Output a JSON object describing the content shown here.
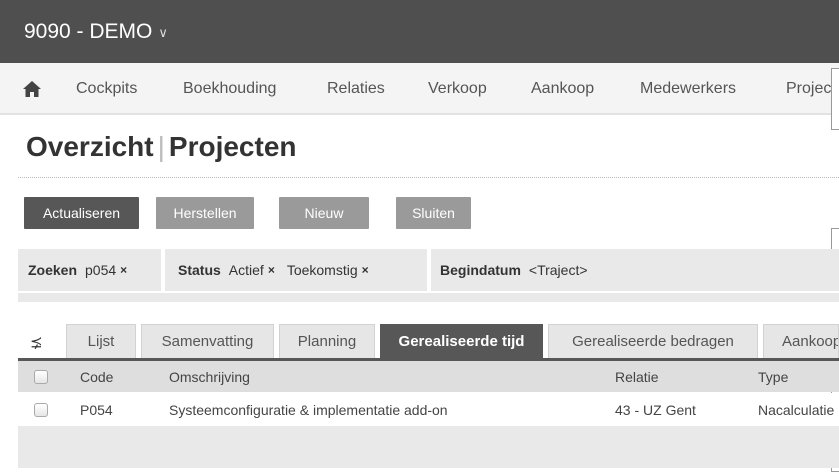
{
  "topbar": {
    "company": "9090 - DEMO",
    "chevron": "∨"
  },
  "nav": {
    "home_icon": "home-icon",
    "items": [
      "Cockpits",
      "Boekhouding",
      "Relaties",
      "Verkoop",
      "Aankoop",
      "Medewerkers",
      "Projecten"
    ]
  },
  "page": {
    "title_part1": "Overzicht",
    "title_sep": "|",
    "title_part2": "Projecten"
  },
  "toolbar": {
    "actualiseren": "Actualiseren",
    "herstellen": "Herstellen",
    "nieuw": "Nieuw",
    "sluiten": "Sluiten"
  },
  "filters": {
    "zoeken_label": "Zoeken",
    "zoeken_value": "p054",
    "status_label": "Status",
    "status_value1": "Actief",
    "status_value2": "Toekomstig",
    "begindatum_label": "Begindatum",
    "begindatum_value": "<Traject>",
    "remove": "×"
  },
  "tabs": {
    "pin_icon": "⪱",
    "items": [
      "Lijst",
      "Samenvatting",
      "Planning",
      "Gerealiseerde tijd",
      "Gerealiseerde bedragen",
      "Aankoop"
    ],
    "active_index": 3
  },
  "table": {
    "headers": {
      "code": "Code",
      "omschrijving": "Omschrijving",
      "relatie": "Relatie",
      "type": "Type"
    },
    "rows": [
      {
        "code": "P054",
        "omschrijving": "Systeemconfiguratie & implementatie add-on",
        "relatie": "43 - UZ Gent",
        "type": "Nacalculatie"
      }
    ]
  },
  "colors": {
    "topbar": "#4f4f4f",
    "active_tab": "#575757",
    "button": "#9a9a9a",
    "button_primary": "#575757"
  }
}
